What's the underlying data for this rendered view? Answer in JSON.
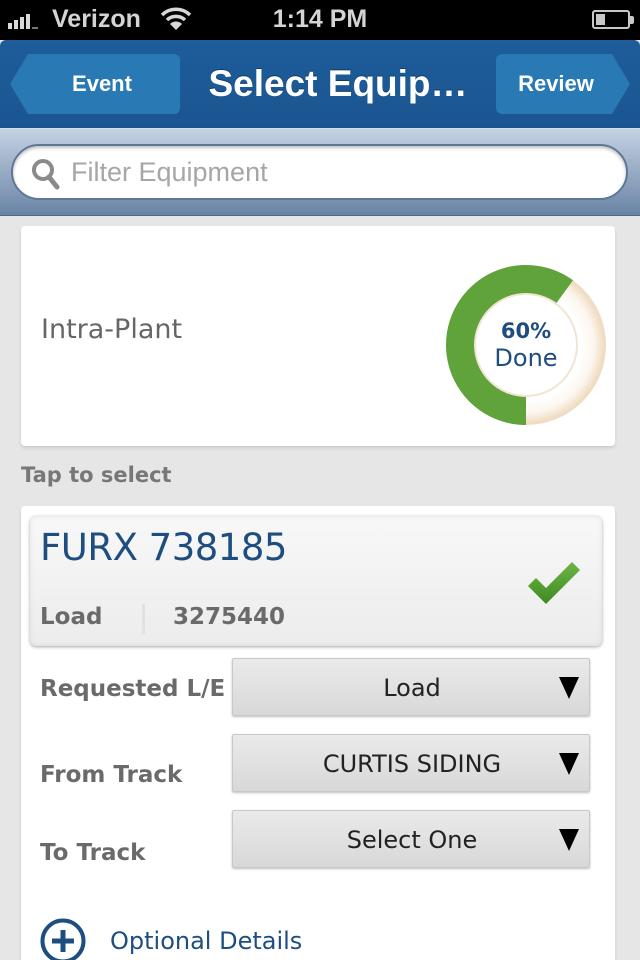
{
  "status_bar": {
    "carrier": "Verizon",
    "time": "1:14 PM",
    "signal_bars": 4,
    "battery_level": 0.3,
    "icons": {
      "signal": "signal-bars-icon",
      "wifi": "wifi-icon",
      "battery": "battery-icon"
    }
  },
  "nav": {
    "back_label": "Event",
    "title": "Select Equip…",
    "forward_label": "Review"
  },
  "search": {
    "placeholder": "Filter Equipment",
    "value": "",
    "icon": "search-icon"
  },
  "event": {
    "name": "Intra-Plant",
    "progress": {
      "value": 0.6,
      "percent_label": "60%",
      "caption": "Done",
      "color_done": "#5fa33a",
      "color_remaining": "#fbf7f1"
    }
  },
  "section_label": "Tap to select",
  "equipment": {
    "id": "FURX 738185",
    "load_empty": "Load",
    "number": "3275440",
    "selected": true,
    "check_icon": "checkmark-icon"
  },
  "form": {
    "fields": [
      {
        "label": "Requested L/E",
        "value": "Load"
      },
      {
        "label": "From Track",
        "value": "CURTIS SIDING"
      },
      {
        "label": "To Track",
        "value": "Select One"
      }
    ],
    "optional_details_label": "Optional Details"
  },
  "colors": {
    "nav_blue": "#1d5d9a",
    "nav_button": "#2879b4",
    "text_blue": "#1e4e7f",
    "check_green": "#4f9a2e"
  }
}
